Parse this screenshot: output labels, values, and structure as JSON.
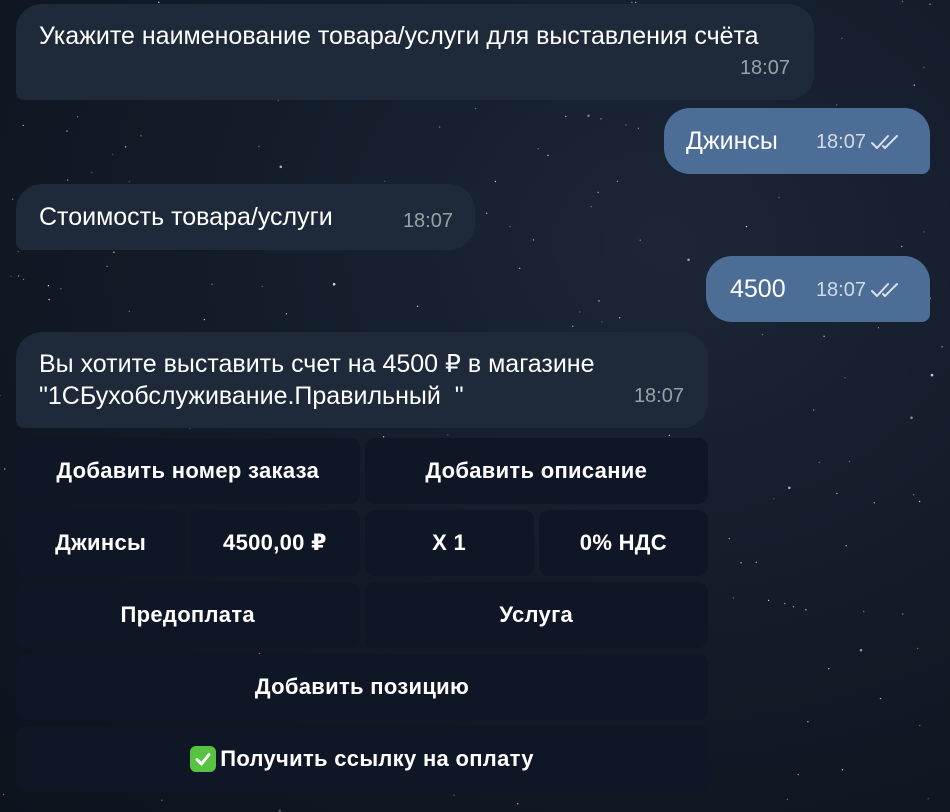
{
  "messages": [
    {
      "direction": "in",
      "text": "Укажите наименование товара/услуги для выставления счёта",
      "time": "18:07"
    },
    {
      "direction": "out",
      "text": "Джинсы",
      "time": "18:07"
    },
    {
      "direction": "in",
      "text": "Стоимость товара/услуги",
      "time": "18:07"
    },
    {
      "direction": "out",
      "text": "4500",
      "time": "18:07"
    },
    {
      "direction": "in",
      "text": "Вы хотите выставить счет на 4500 ₽ в магазине\n\"1СБухобслуживание.Правильный  \"",
      "time": "18:07"
    }
  ],
  "keyboard": {
    "row1": [
      "Добавить номер заказа",
      "Добавить описание"
    ],
    "row2": [
      "Джинсы",
      "4500,00 ₽",
      "Х 1",
      "0% НДС"
    ],
    "row3": [
      "Предоплата",
      "Услуга"
    ],
    "row4": [
      "Добавить позицию"
    ],
    "row5": [
      "Получить ссылку на оплату"
    ]
  },
  "icons": {
    "read_ticks": "double-check-icon",
    "pay_link": "check-mark-icon"
  },
  "colors": {
    "incoming_bubble": "#1e2a3a",
    "outgoing_bubble": "#4b6d96",
    "keyboard_button": "#0f1726",
    "check_green": "#57c340"
  }
}
